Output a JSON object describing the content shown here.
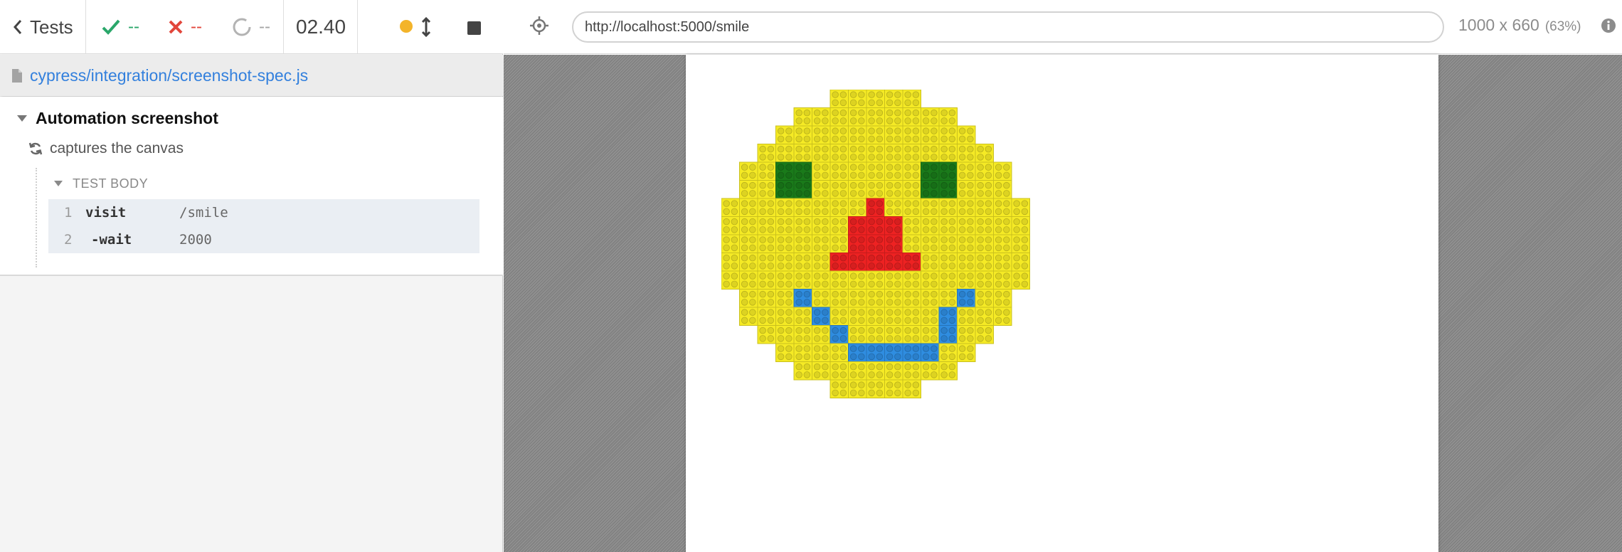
{
  "reporter": {
    "tests_label": "Tests",
    "passed": "--",
    "failed": "--",
    "pending": "--",
    "duration": "02.40",
    "running_dot_color": "#f3b42a",
    "spec_path": "cypress/integration/screenshot-spec.js",
    "suite_title": "Automation screenshot",
    "test_title": "captures the canvas",
    "test_body_label": "TEST BODY",
    "commands": [
      {
        "number": "1",
        "name": "visit",
        "message": "/smile"
      },
      {
        "number": "2",
        "name": "-wait",
        "message": "2000"
      }
    ]
  },
  "aut": {
    "url": "http://localhost:5000/smile",
    "viewport": "1000 x 660",
    "scale": "(63%)"
  },
  "icons": [
    "chevron-left-icon",
    "check-icon",
    "x-icon",
    "pending-circle-icon",
    "scroll-toggle-icon",
    "stop-icon",
    "file-icon",
    "refresh-icon",
    "crosshair-icon",
    "info-icon"
  ],
  "colors": {
    "passed": "#2aa76a",
    "failed": "#e2463b",
    "link": "#3380dd",
    "brick_yellow": "#f5ea25",
    "brick_green": "#1a7a1a",
    "brick_red": "#ee2222",
    "brick_blue": "#2f8de0"
  },
  "artwork": {
    "brick_colors": {
      "Y": "#f5ea25",
      "G": "#1a7a1a",
      "R": "#ee2222",
      "B": "#2f8de0"
    },
    "rows": [
      "......YYYYY......",
      "....YYYYYYYYY....",
      "...YYYYYYYYYYY...",
      "..YYYYYYYYYYYYY..",
      ".YYGGYYYYYYGGYYY.",
      ".YYGGYYYYYYGGYYY.",
      "YYYYYYYYRYYYYYYYY",
      "YYYYYYYRRRYYYYYYY",
      "YYYYYYYRRRYYYYYYY",
      "YYYYYYRRRRRYYYYYY",
      "YYYYYYYYYYYYYYYYY",
      ".YYYBYYYYYYYYBYY.",
      ".YYYYBYYYYYYBYYY.",
      "..YYYYBYYYYYBYY..",
      "...YYYYBBBBBYY...",
      "....YYYYYYYYY....",
      "......YYYYY......"
    ]
  }
}
